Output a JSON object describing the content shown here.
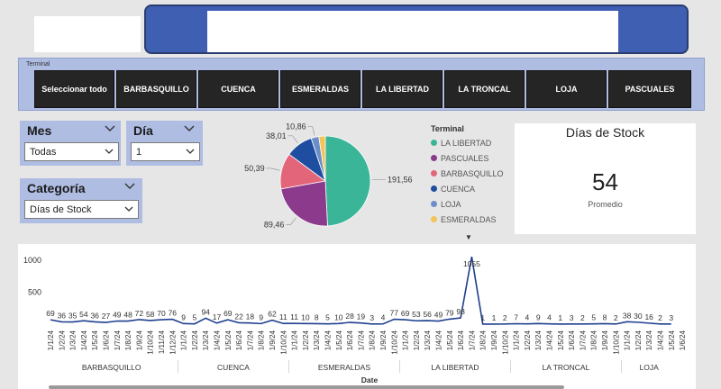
{
  "slicer": {
    "title": "Terminal",
    "items": [
      "Seleccionar todo",
      "BARBASQUILLO",
      "CUENCA",
      "ESMERALDAS",
      "LA LIBERTAD",
      "LA TRONCAL",
      "LOJA",
      "PASCUALES"
    ]
  },
  "filters": {
    "mes": {
      "label": "Mes",
      "value": "Todas"
    },
    "dia": {
      "label": "Día",
      "value": "1"
    },
    "categoria": {
      "label": "Categoría",
      "value": "Días de Stock"
    }
  },
  "kpi": {
    "title": "Días de Stock",
    "value": "54",
    "subtitle": "Promedio"
  },
  "colors": {
    "accent": "#3f5fb3",
    "panel": "#afbde3",
    "line": "#1f3f8f",
    "la_libertad": "#3bb598",
    "pascuales": "#8b3a8c",
    "barbasquillo": "#e2657a",
    "cuenca": "#1f4ea0",
    "loja": "#6b8ec8",
    "esmeraldas": "#f2c45a"
  },
  "chart_data": [
    {
      "type": "pie",
      "legend_title": "Terminal",
      "slices": [
        {
          "name": "LA LIBERTAD",
          "value": 191.56,
          "label": "191,56",
          "color": "#3bb598"
        },
        {
          "name": "PASCUALES",
          "value": 89.46,
          "label": "89,46",
          "color": "#8b3a8c"
        },
        {
          "name": "BARBASQUILLO",
          "value": 50.39,
          "label": "50,39",
          "color": "#e2657a"
        },
        {
          "name": "CUENCA",
          "value": 38.01,
          "label": "38,01",
          "color": "#1f4ea0"
        },
        {
          "name": "LOJA",
          "value": 10.86,
          "label": "10,86",
          "color": "#6b8ec8"
        },
        {
          "name": "ESMERALDAS",
          "value": 9.0,
          "label": "",
          "color": "#f2c45a"
        }
      ]
    },
    {
      "type": "line",
      "xlabel": "Date",
      "ylabel": "",
      "ylim": [
        0,
        1100
      ],
      "yticks": [
        500,
        1000
      ],
      "series": [
        {
          "values": [
            69,
            36,
            35,
            54,
            36,
            27,
            49,
            48,
            72,
            58,
            70,
            76,
            9,
            5,
            94,
            17,
            69,
            22,
            18,
            9,
            62,
            11,
            11,
            10,
            8,
            5,
            10,
            28,
            19,
            3,
            4,
            77,
            69,
            53,
            56,
            49,
            79,
            98,
            1055,
            1,
            1,
            2,
            7,
            4,
            9,
            4,
            1,
            3,
            2,
            5,
            8,
            2,
            38,
            30,
            16,
            2,
            3
          ]
        }
      ],
      "labels": [
        "69",
        "36",
        "35",
        "54",
        "36",
        "27",
        "49",
        "48",
        "72",
        "58",
        "70",
        "76",
        "9",
        "5",
        "94",
        "17",
        "69",
        "22",
        "18",
        "9",
        "62",
        "11",
        "11",
        "10",
        "8",
        "5",
        "10",
        "28",
        "19",
        "3",
        "4",
        "77",
        "69",
        "53",
        "56",
        "49",
        "79",
        "98",
        "1055",
        "1",
        "1",
        "2",
        "7",
        "4",
        "9",
        "4",
        "1",
        "3",
        "2",
        "5",
        "8",
        "2",
        "38",
        "30",
        "16",
        "2",
        "3"
      ],
      "x_labels": [
        "1/1/24",
        "1/2/24",
        "1/3/24",
        "1/4/24",
        "1/5/24",
        "1/6/24",
        "1/7/24",
        "1/8/24",
        "1/9/24",
        "1/10/24",
        "1/11/24",
        "1/12/24",
        "1/1/24",
        "1/2/24",
        "1/3/24",
        "1/4/24",
        "1/5/24",
        "1/6/24",
        "1/7/24",
        "1/8/24",
        "1/9/24",
        "1/10/24",
        "1/1/24",
        "1/2/24",
        "1/3/24",
        "1/4/24",
        "1/5/24",
        "1/6/24",
        "1/7/24",
        "1/8/24",
        "1/9/24",
        "1/10/24",
        "1/1/24",
        "1/2/24",
        "1/3/24",
        "1/4/24",
        "1/5/24",
        "1/6/24",
        "1/7/24",
        "1/8/24",
        "1/9/24",
        "1/10/24",
        "1/1/24",
        "1/2/24",
        "1/3/24",
        "1/4/24",
        "1/5/24",
        "1/6/24",
        "1/7/24",
        "1/8/24",
        "1/9/24",
        "1/10/24",
        "1/1/24",
        "1/2/24",
        "1/3/24",
        "1/4/24",
        "1/5/24",
        "1/6/24",
        "1/7/24",
        "1/8/24",
        "1/9/24",
        "1/10/24"
      ],
      "groups": [
        {
          "name": "BARBASQUILLO",
          "count": 12
        },
        {
          "name": "CUENCA",
          "count": 10
        },
        {
          "name": "ESMERALDAS",
          "count": 10
        },
        {
          "name": "LA LIBERTAD",
          "count": 10
        },
        {
          "name": "LA TRONCAL",
          "count": 10
        },
        {
          "name": "LOJA",
          "count": 5
        }
      ]
    }
  ]
}
